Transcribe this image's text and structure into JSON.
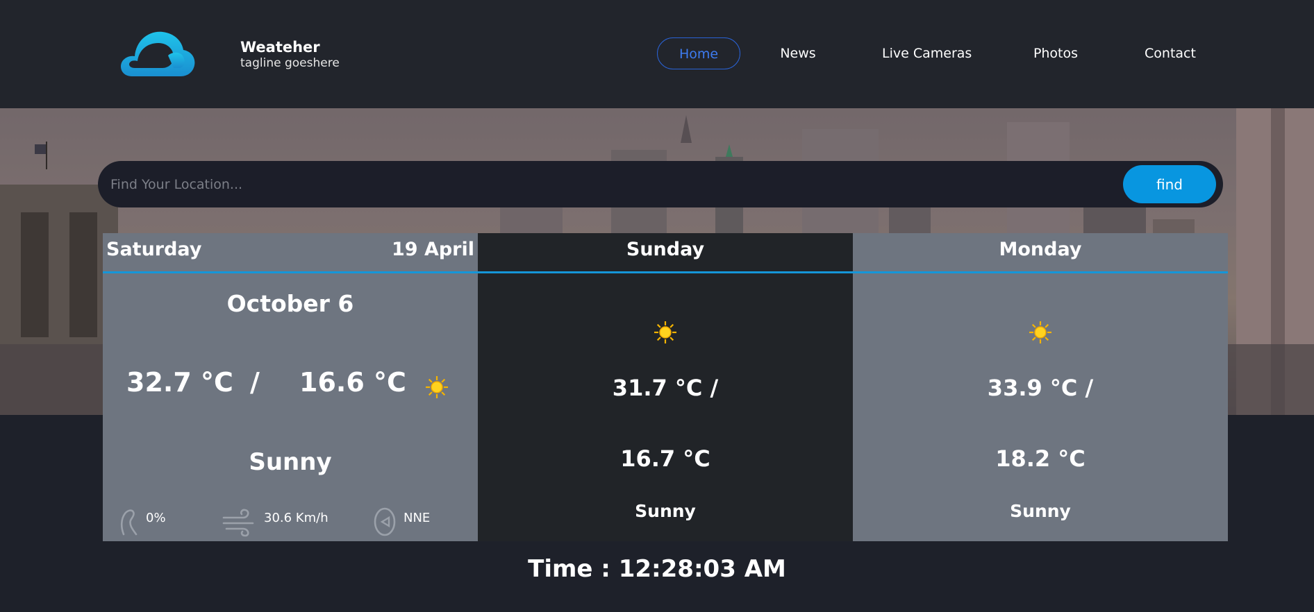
{
  "brand": {
    "name": "Weateher",
    "tagline": "tagline goeshere"
  },
  "nav": {
    "items": [
      {
        "label": "Home",
        "active": true
      },
      {
        "label": "News"
      },
      {
        "label": "Live Cameras"
      },
      {
        "label": "Photos"
      },
      {
        "label": "Contact"
      }
    ]
  },
  "search": {
    "placeholder": "Find Your Location...",
    "button_label": "find"
  },
  "today": {
    "day": "Saturday",
    "date": "19 April",
    "headline_date": "October 6",
    "high": "32.7 °C",
    "separator": "/",
    "low": "16.6 °C",
    "condition": "Sunny",
    "icon": "sun-icon",
    "humidity": "0%",
    "wind_speed": "30.6 Km/h",
    "wind_direction": "NNE"
  },
  "forecast": [
    {
      "day": "Sunday",
      "high": "31.7 °C /",
      "low": "16.7 °C",
      "condition": "Sunny",
      "icon": "sun-icon"
    },
    {
      "day": "Monday",
      "high": "33.9 °C /",
      "low": "18.2 °C",
      "condition": "Sunny",
      "icon": "sun-icon"
    }
  ],
  "clock": {
    "text": "Time : 12:28:03 AM"
  },
  "colors": {
    "accent": "#0896e0",
    "nav_active": "#2a63d6",
    "panel_light": "#6e7580",
    "panel_dark": "#212428",
    "background": "#1e212a"
  }
}
